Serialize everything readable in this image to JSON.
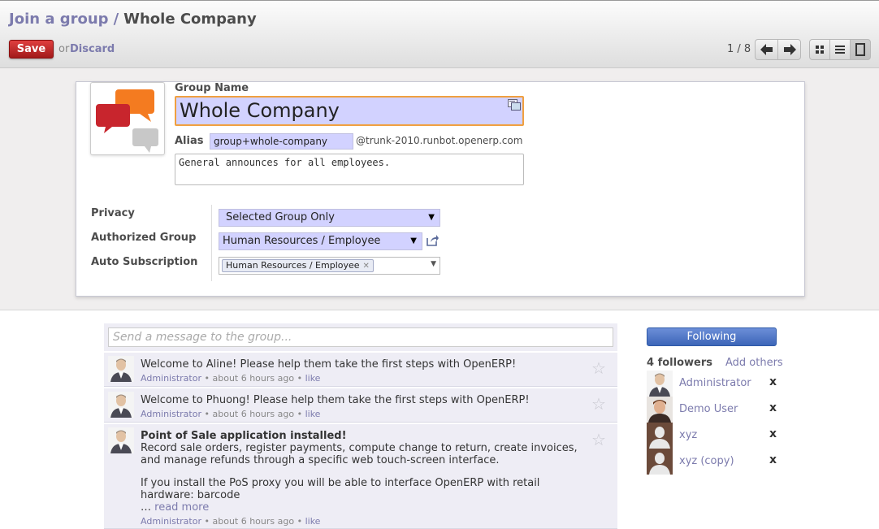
{
  "breadcrumb": {
    "parent": "Join a group",
    "separator": "/",
    "current": "Whole Company"
  },
  "toolbar": {
    "save_label": "Save",
    "or_label": "or",
    "discard_label": "Discard"
  },
  "pager": {
    "text": "1 / 8"
  },
  "form": {
    "name_label": "Group Name",
    "name_value": "Whole Company",
    "alias_label": "Alias",
    "alias_value": "group+whole-company",
    "alias_domain": "@trunk-2010.runbot.openerp.com",
    "description": "General announces for all employees.",
    "privacy_label": "Privacy",
    "privacy_value": "Selected Group Only",
    "authorized_label": "Authorized Group",
    "authorized_value": "Human Resources / Employee",
    "autosub_label": "Auto Subscription",
    "autosub_tags": [
      "Human Resources / Employee"
    ]
  },
  "composer": {
    "placeholder": "Send a message to the group..."
  },
  "messages": [
    {
      "body": "Welcome to Aline! Please help them take the first steps with OpenERP!",
      "author": "Administrator",
      "time": "about 6 hours ago",
      "like": "like"
    },
    {
      "body": "Welcome to Phuong! Please help them take the first steps with OpenERP!",
      "author": "Administrator",
      "time": "about 6 hours ago",
      "like": "like"
    },
    {
      "title": "Point of Sale application installed!",
      "body": "Record sale orders, register payments, compute change to return, create invoices, and manage refunds through a specific web touch-screen interface.",
      "body2": "If you install the PoS proxy you will be able to interface OpenERP with retail hardware: barcode",
      "ellipsis": "…",
      "read_more": "read more",
      "author": "Administrator",
      "time": "about 6 hours ago",
      "like": "like"
    }
  ],
  "followers": {
    "button_label": "Following",
    "count_label": "4 followers",
    "add_label": "Add others",
    "list": [
      {
        "name": "Administrator"
      },
      {
        "name": "Demo User"
      },
      {
        "name": "xyz"
      },
      {
        "name": "xyz (copy)"
      }
    ],
    "remove_glyph": "x"
  },
  "colors": {
    "accent": "#7c7bad",
    "save": "#c02727",
    "following": "#4a72c4",
    "input_bg": "#d2d2ff"
  }
}
